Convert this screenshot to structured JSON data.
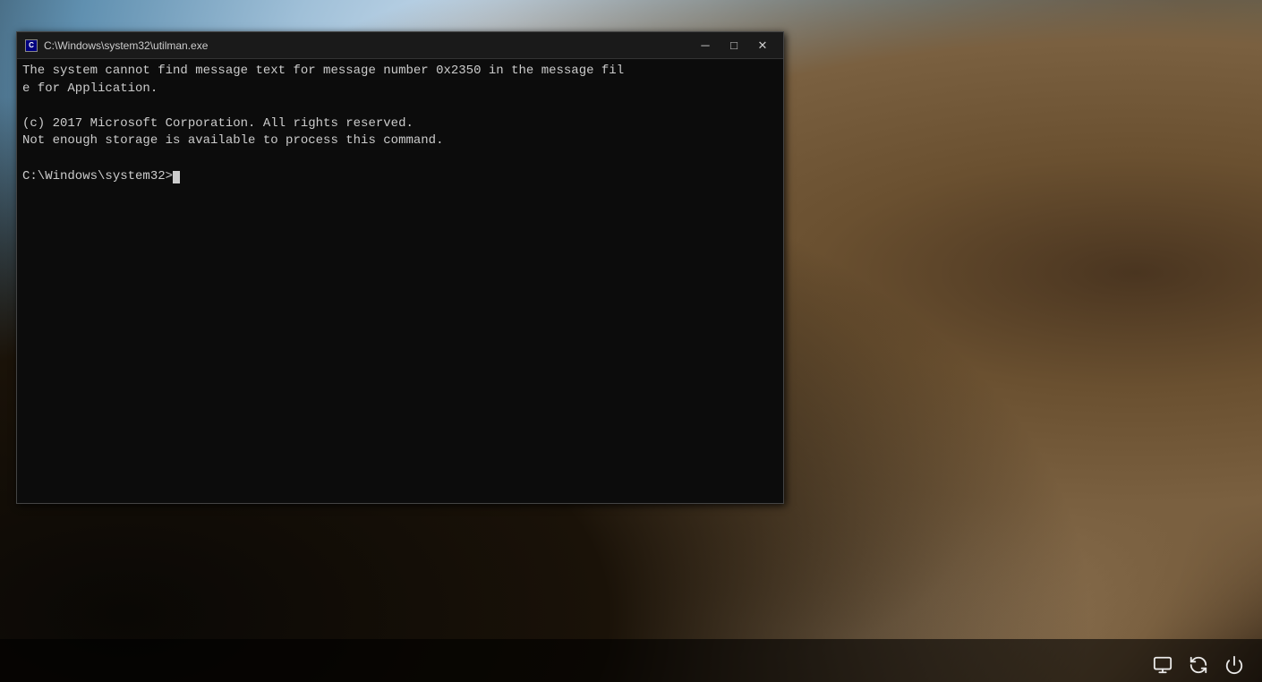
{
  "desktop": {
    "background_desc": "Windows beach/rock scenic wallpaper"
  },
  "cmd_window": {
    "title": "C:\\Windows\\system32\\utilman.exe",
    "icon_label": "cmd",
    "output_lines": [
      "The system cannot find message text for message number 0x2350 in the message fil",
      "e for Application.",
      "",
      "(c) 2017 Microsoft Corporation. All rights reserved.",
      "Not enough storage is available to process this command.",
      "",
      "C:\\Windows\\system32>"
    ],
    "minimize_label": "─",
    "maximize_label": "□",
    "close_label": "✕",
    "prompt": "C:\\Windows\\system32>"
  },
  "taskbar": {
    "tray_icons": [
      {
        "name": "display-icon",
        "label": "Display"
      },
      {
        "name": "refresh-icon",
        "label": "Refresh/Update"
      },
      {
        "name": "power-icon",
        "label": "Power"
      }
    ]
  }
}
